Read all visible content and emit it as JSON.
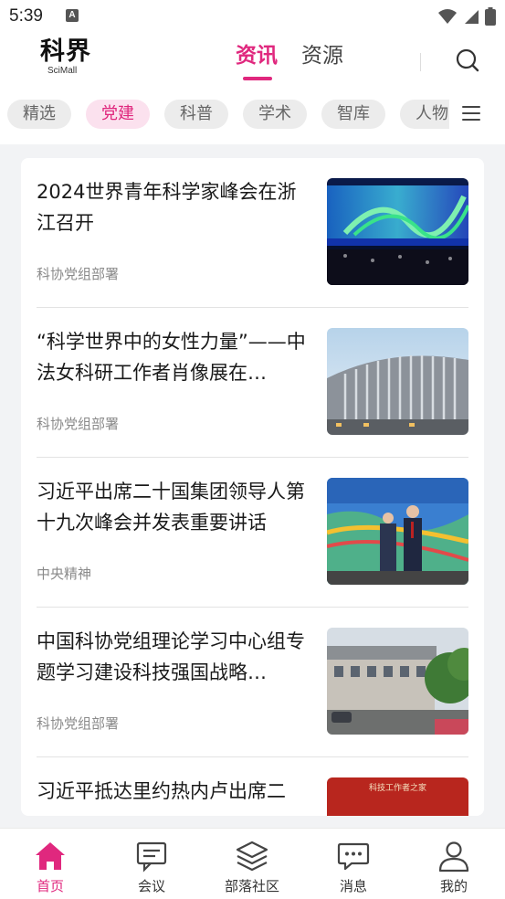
{
  "status_bar": {
    "time": "5:39",
    "notification_letter": "A"
  },
  "header": {
    "logo_text": "科界",
    "logo_sub": "SciMall",
    "tabs": [
      {
        "label": "资讯",
        "active": true
      },
      {
        "label": "资源",
        "active": false
      }
    ],
    "search_icon": "search-icon"
  },
  "categories": [
    {
      "label": "精选",
      "active": false
    },
    {
      "label": "党建",
      "active": true
    },
    {
      "label": "科普",
      "active": false
    },
    {
      "label": "学术",
      "active": false
    },
    {
      "label": "智库",
      "active": false
    },
    {
      "label": "人物",
      "active": false
    }
  ],
  "news": [
    {
      "title": "2024世界青年科学家峰会在浙江召开",
      "source": "科协党组部署",
      "thumb": "summit-stage-photo"
    },
    {
      "title": "“科学世界中的女性力量”——中法女科研工作者肖像展在…",
      "source": "科协党组部署",
      "thumb": "modern-building-photo"
    },
    {
      "title": "习近平出席二十国集团领导人第十九次峰会并发表重要讲话",
      "source": "中央精神",
      "thumb": "g20-summit-photo"
    },
    {
      "title": "中国科协党组理论学习中心组专题学习建设科技强国战略…",
      "source": "科协党组部署",
      "thumb": "office-building-photo"
    },
    {
      "title": "习近平抵达里约热内卢出席二",
      "source": "",
      "thumb": "red-banner-photo",
      "thumb_caption": "科技工作者之家"
    }
  ],
  "bottom_nav": [
    {
      "label": "首页",
      "icon": "home-icon",
      "active": true
    },
    {
      "label": "会议",
      "icon": "meeting-icon",
      "active": false
    },
    {
      "label": "部落社区",
      "icon": "layers-icon",
      "active": false
    },
    {
      "label": "消息",
      "icon": "message-icon",
      "active": false
    },
    {
      "label": "我的",
      "icon": "user-icon",
      "active": false
    }
  ],
  "colors": {
    "accent": "#e0287e",
    "chip_bg": "#ececec",
    "chip_active_bg": "#fbe1ee",
    "page_bg": "#f2f3f5"
  }
}
